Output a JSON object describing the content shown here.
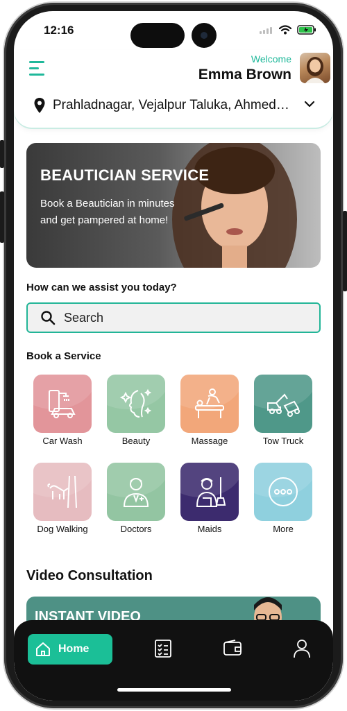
{
  "status_bar": {
    "time": "12:16"
  },
  "header": {
    "welcome": "Welcome",
    "user_name": "Emma Brown",
    "location": "Prahladnagar, Vejalpur Taluka, Ahmedabad"
  },
  "banner": {
    "title": "BEAUTICIAN SERVICE",
    "text": "Book a Beautician in minutes and get pampered at home!"
  },
  "assist": {
    "heading": "How can we assist you today?",
    "search_placeholder": "Search"
  },
  "services": {
    "heading": "Book a Service",
    "items": [
      {
        "label": "Car Wash",
        "icon": "car-wash-icon",
        "color": "#e2959a"
      },
      {
        "label": "Beauty",
        "icon": "beauty-icon",
        "color": "#95c7a4"
      },
      {
        "label": "Massage",
        "icon": "massage-icon",
        "color": "#f2a77a"
      },
      {
        "label": "Tow Truck",
        "icon": "tow-truck-icon",
        "color": "#4f9889"
      },
      {
        "label": "Dog Walking",
        "icon": "dog-walking-icon",
        "color": "#e6bcc0"
      },
      {
        "label": "Doctors",
        "icon": "doctor-icon",
        "color": "#93c5a2"
      },
      {
        "label": "Maids",
        "icon": "maid-icon",
        "color": "#3c2b6e"
      },
      {
        "label": "More",
        "icon": "more-icon",
        "color": "#8fd0de"
      }
    ]
  },
  "video": {
    "heading": "Video Consultation",
    "card_title": "INSTANT VIDEO"
  },
  "bottom_nav": {
    "home_label": "Home"
  },
  "colors": {
    "accent": "#1bbf97",
    "nav_bg": "#111111"
  }
}
